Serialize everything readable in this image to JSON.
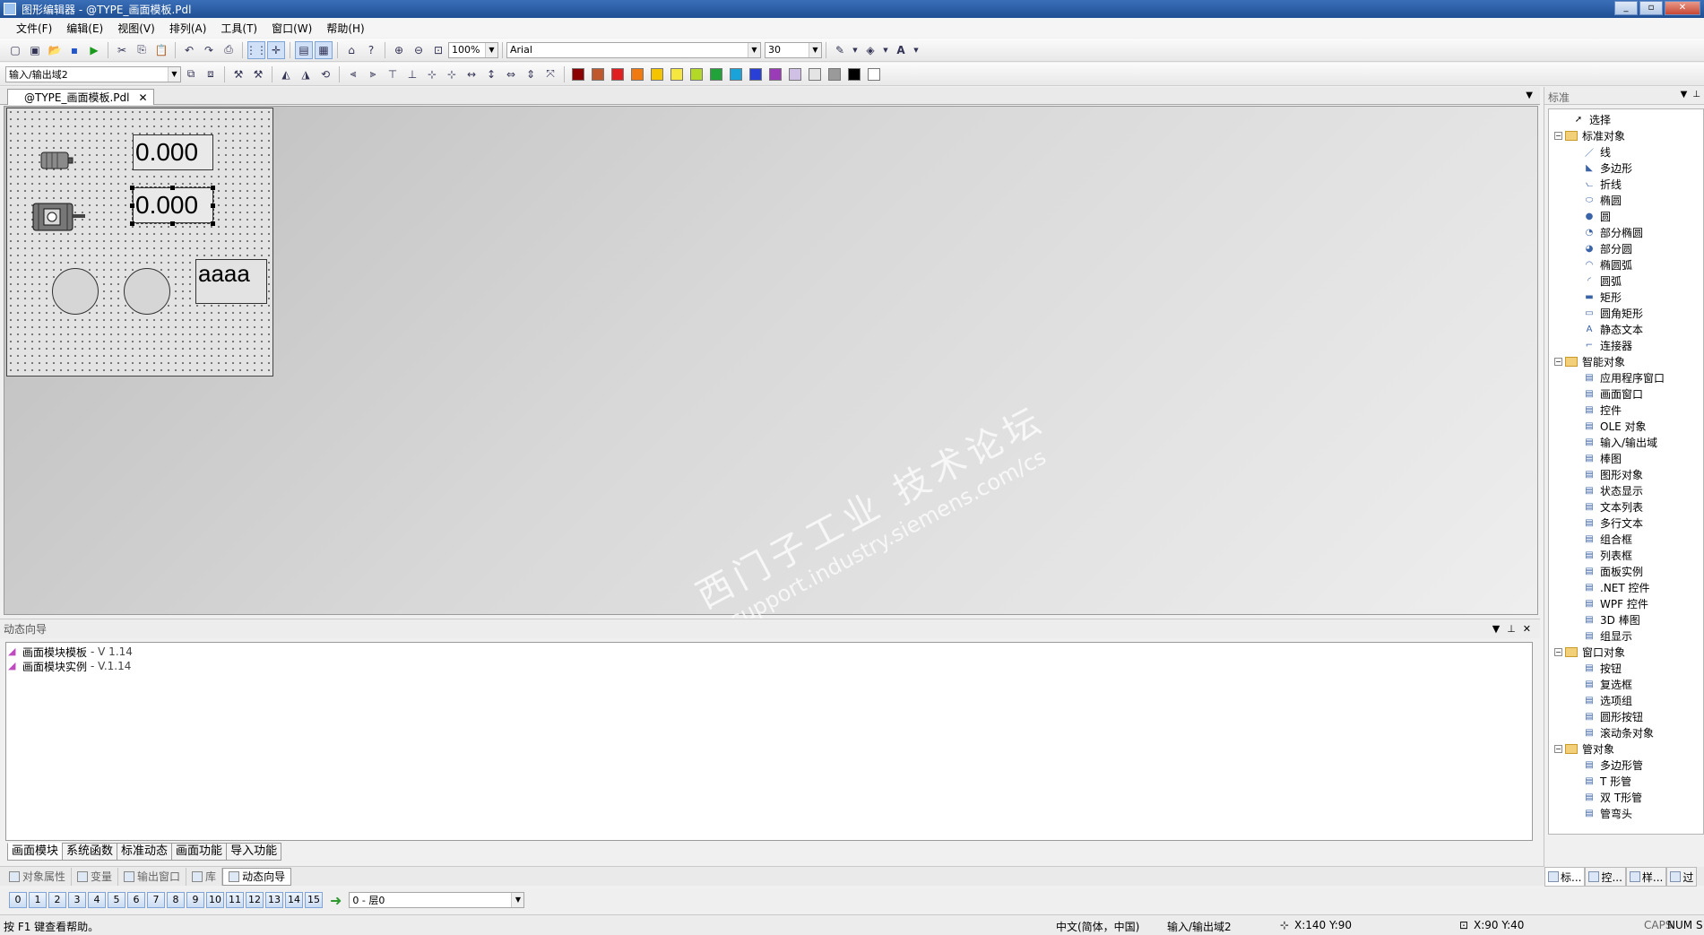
{
  "window": {
    "title": "图形编辑器 - @TYPE_画面模板.Pdl"
  },
  "menu": [
    "文件(F)",
    "编辑(E)",
    "视图(V)",
    "排列(A)",
    "工具(T)",
    "窗口(W)",
    "帮助(H)"
  ],
  "toolbar": {
    "zoom": "100%",
    "font": "Arial",
    "font_size": "30",
    "object_combo": "输入/输出域2",
    "palette": [
      "#8b0000",
      "#c0582e",
      "#e02020",
      "#f07a10",
      "#f5c400",
      "#f5e640",
      "#b4d828",
      "#21a33a",
      "#1aa3d9",
      "#2a3fd6",
      "#9b3bb8",
      "#d0c0e6",
      "#e4e4e4",
      "#9a9a9a",
      "#000000",
      "#ffffff"
    ]
  },
  "document": {
    "tab_label": "@TYPE_画面模板.Pdl",
    "io1": "0.000",
    "io2": "0.000",
    "text1": "aaaa"
  },
  "watermark": {
    "line1": "西门子工业 技术论坛",
    "line2": "support.industry.siemens.com/cs"
  },
  "wizard": {
    "title": "动态向导",
    "items": [
      {
        "label": "画面模块模板",
        "version": "- V 1.14"
      },
      {
        "label": "画面模块实例",
        "version": "- V.1.14"
      }
    ],
    "tabs": [
      "画面模块",
      "系统函数",
      "标准动态",
      "画面功能",
      "导入功能"
    ]
  },
  "dock_tabs": [
    "对象属性",
    "变量",
    "输出窗口",
    "库",
    "动态向导"
  ],
  "layers": {
    "buttons": [
      "0",
      "1",
      "2",
      "3",
      "4",
      "5",
      "6",
      "7",
      "8",
      "9",
      "10",
      "11",
      "12",
      "13",
      "14",
      "15"
    ],
    "current": "0 - 层0"
  },
  "status": {
    "help": "按 F1 键查看帮助。",
    "language": "中文(简体，中国)",
    "object": "输入/输出域2",
    "position": "X:140 Y:90",
    "size": "X:90 Y:40",
    "caps": "CAPS",
    "num": "NUM",
    "scrl": "S"
  },
  "rpanel": {
    "title": "标准",
    "tree": {
      "select": "选择",
      "standard": "标准对象",
      "standard_items": [
        "线",
        "多边形",
        "折线",
        "椭圆",
        "圆",
        "部分椭圆",
        "部分圆",
        "椭圆弧",
        "圆弧",
        "矩形",
        "圆角矩形",
        "静态文本",
        "连接器"
      ],
      "smart": "智能对象",
      "smart_items": [
        "应用程序窗口",
        "画面窗口",
        "控件",
        "OLE 对象",
        "输入/输出域",
        "棒图",
        "图形对象",
        "状态显示",
        "文本列表",
        "多行文本",
        "组合框",
        "列表框",
        "面板实例",
        ".NET 控件",
        "WPF 控件",
        "3D 棒图",
        "组显示"
      ],
      "window": "窗口对象",
      "window_items": [
        "按钮",
        "复选框",
        "选项组",
        "圆形按钮",
        "滚动条对象"
      ],
      "pipe": "管对象",
      "pipe_items": [
        "多边形管",
        "T 形管",
        "双 T形管",
        "管弯头"
      ]
    },
    "tabs": [
      "标...",
      "控...",
      "样...",
      "过"
    ]
  }
}
